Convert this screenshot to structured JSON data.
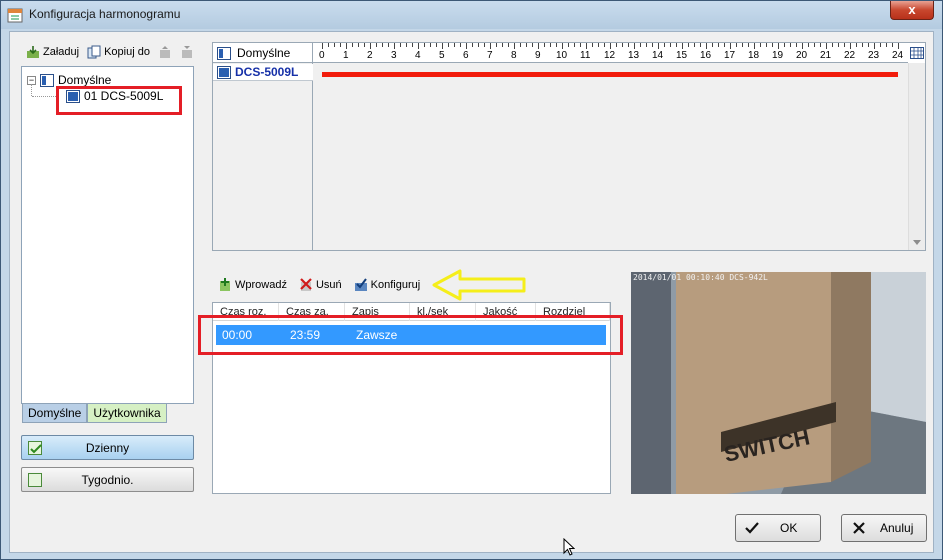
{
  "window": {
    "title": "Konfiguracja harmonogramu",
    "close_glyph": "x"
  },
  "left_toolbar": {
    "load_label": "Załaduj",
    "copy_label": "Kopiuj do"
  },
  "tree": {
    "root_label": "Domyślne",
    "child_label": "01 DCS-5009L",
    "expander": "−"
  },
  "tabs": [
    "Domyślne",
    "Użytkownika"
  ],
  "mode_buttons": {
    "daily": "Dzienny",
    "weekly": "Tygodnio."
  },
  "schedule": {
    "column_header": "Domyślne",
    "camera_label": "DCS-5009L",
    "hours": [
      "0",
      "1",
      "2",
      "3",
      "4",
      "5",
      "6",
      "7",
      "8",
      "9",
      "10",
      "11",
      "12",
      "13",
      "14",
      "15",
      "16",
      "17",
      "18",
      "19",
      "20",
      "21",
      "22",
      "23",
      "24"
    ],
    "recording_from_hour": 0,
    "recording_to_hour": 24,
    "bar_color": "#f21c0c"
  },
  "actions": {
    "add_label": "Wprowadź",
    "remove_label": "Usuń",
    "configure_label": "Konfiguruj"
  },
  "list": {
    "columns": [
      "Czas roz.",
      "Czas za.",
      "Zapis",
      "kl./sek",
      "Jakość",
      "Rozdziel"
    ],
    "rows": [
      {
        "start": "00:00",
        "end": "23:59",
        "record": "Zawsze"
      }
    ]
  },
  "preview": {
    "osd": "2014/01/01 00:10:40 DCS-942L",
    "box_text": "SWITCH"
  },
  "dialog_buttons": {
    "ok": "OK",
    "cancel": "Anuluj"
  },
  "colors": {
    "highlight": "#e41e26",
    "arrow": "#f5ee1a",
    "selection": "#3399ff"
  }
}
